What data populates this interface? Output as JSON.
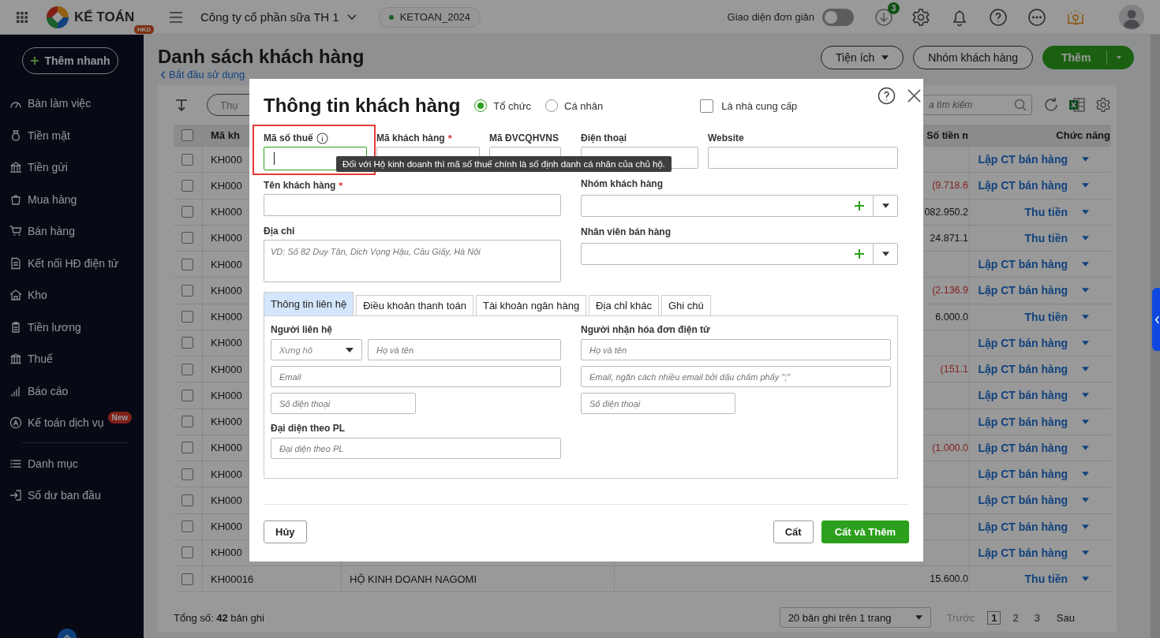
{
  "topbar": {
    "app_name": "KẾ TOÁN",
    "app_badge": "HKD",
    "company": "Công ty cổ phần sữa TH 1",
    "database": "KETOAN_2024",
    "simple_mode": {
      "label": "Giao diện đơn giản",
      "on": false
    },
    "download_count": "3"
  },
  "sidebar": {
    "quick_add": "Thêm nhanh",
    "groups": [
      [
        {
          "label": "Bàn làm việc"
        },
        {
          "label": "Tiền mặt"
        },
        {
          "label": "Tiền gửi"
        },
        {
          "label": "Mua hàng"
        },
        {
          "label": "Bán hàng"
        },
        {
          "label": "Kết nối HĐ điện tử"
        },
        {
          "label": "Kho"
        },
        {
          "label": "Tiền lương"
        },
        {
          "label": "Thuế"
        },
        {
          "label": "Báo cáo"
        },
        {
          "label": "Kế toán dịch vụ",
          "badge": "New"
        }
      ],
      [
        {
          "label": "Danh mục"
        },
        {
          "label": "Số dư ban đầu"
        }
      ]
    ]
  },
  "page": {
    "title": "Danh sách khách hàng",
    "back_link": "Bắt đầu sử dụng",
    "utilities": "Tiện ích",
    "customer_groups": "Nhóm khách hàng",
    "add": "Thêm",
    "filter_chip": "Thụ",
    "search_placeholder": "a tìm kiếm"
  },
  "table": {
    "select_all_checked": false,
    "columns": {
      "code": "Mã kh",
      "amount": "Số tiền n",
      "action": "Chức năng"
    },
    "rows": [
      {
        "checked": false,
        "code": "KH000",
        "action": "Lập CT bán hàng"
      },
      {
        "checked": false,
        "code": "KH000",
        "amount": "(9.718.6",
        "negative": true,
        "action": "Lập CT bán hàng"
      },
      {
        "checked": false,
        "code": "KH000",
        "amount": "082.950.2",
        "negative": false,
        "action": "Thu tiền"
      },
      {
        "checked": false,
        "code": "KH000",
        "amount": "24.871.1",
        "negative": false,
        "action": "Thu tiền"
      },
      {
        "checked": false,
        "code": "KH000",
        "action": "Lập CT bán hàng"
      },
      {
        "checked": false,
        "code": "KH000",
        "amount": "(2.136.9",
        "negative": true,
        "action": "Lập CT bán hàng"
      },
      {
        "checked": false,
        "code": "KH000",
        "amount": "6.000.0",
        "negative": false,
        "action": "Thu tiền"
      },
      {
        "checked": false,
        "code": "KH000",
        "action": "Lập CT bán hàng"
      },
      {
        "checked": false,
        "code": "KH000",
        "amount": "(151.1",
        "negative": true,
        "action": "Lập CT bán hàng"
      },
      {
        "checked": false,
        "code": "KH000",
        "action": "Lập CT bán hàng"
      },
      {
        "checked": false,
        "code": "KH000",
        "action": "Lập CT bán hàng"
      },
      {
        "checked": false,
        "code": "KH000",
        "amount": "(1.000.0",
        "negative": true,
        "action": "Lập CT bán hàng"
      },
      {
        "checked": false,
        "code": "KH000",
        "action": "Lập CT bán hàng"
      },
      {
        "checked": false,
        "code": "KH000",
        "action": "Lập CT bán hàng"
      },
      {
        "checked": false,
        "code": "KH000",
        "action": "Lập CT bán hàng"
      },
      {
        "checked": false,
        "code": "KH000",
        "action": "Lập CT bán hàng"
      },
      {
        "checked": false,
        "code": "KH00016",
        "name": "HỘ KINH DOANH NAGOMI",
        "amount": "15.600.0",
        "negative": false,
        "action": "Thu tiền"
      }
    ],
    "total": "Tổng số: **42** bản ghi",
    "pagination": {
      "page_size": "20 bản ghi trên 1 trang",
      "prev": {
        "label": "Trước",
        "disabled": true
      },
      "pages": [
        {
          "label": "1",
          "selected": true
        },
        {
          "label": "2",
          "selected": false
        },
        {
          "label": "3",
          "selected": false
        }
      ],
      "next": {
        "label": "Sau",
        "disabled": false
      }
    }
  },
  "modal": {
    "title": "Thông tin khách hàng",
    "customer_type": [
      {
        "label": "Tổ chức",
        "selected": true
      },
      {
        "label": "Cá nhân",
        "selected": false
      }
    ],
    "is_supplier": {
      "label": "Là nhà cung cấp",
      "checked": false
    },
    "code_fields": [
      {
        "label": "Mã số thuế",
        "info": true,
        "focused": true,
        "highlighted": true
      },
      {
        "label": "Mã khách hàng",
        "required_mark": "*",
        "info": false,
        "focused": false,
        "highlighted": false
      },
      {
        "label": "Mã ĐVCQHVNS",
        "info": false,
        "focused": false,
        "highlighted": false
      }
    ],
    "contact_fields": [
      {
        "label": "Điện thoại"
      },
      {
        "label": "Website"
      }
    ],
    "tooltip": "Đối với Hộ kinh doanh thì mã số thuế chính là số định danh cá nhân của chủ hộ.",
    "name_field": {
      "label": "Tên khách hàng",
      "required_mark": "*"
    },
    "group_field": {
      "label": "Nhóm khách hàng"
    },
    "address_field": {
      "label": "Địa chỉ",
      "placeholder": "VD: Số 82 Duy Tân, Dịch Vọng Hậu, Cầu Giấy, Hà Nội"
    },
    "sales_field": {
      "label": "Nhân viên bán hàng"
    },
    "tabs": [
      {
        "label": "Thông tin liên hệ",
        "selected": true
      },
      {
        "label": "Điều khoản thanh toán",
        "selected": false
      },
      {
        "label": "Tài khoản ngân hàng",
        "selected": false
      },
      {
        "label": "Địa chỉ khác",
        "selected": false
      },
      {
        "label": "Ghi chú",
        "selected": false
      }
    ],
    "contact": {
      "label": "Người liên hệ",
      "salutation_placeholder": "Xưng hô",
      "name_placeholder": "Họ và tên",
      "email_placeholder": "Email",
      "phone_placeholder": "Số điện thoại",
      "legal_rep_label": "Đại diện theo PL",
      "legal_rep_placeholder": "Đại diện theo PL"
    },
    "invoice_receiver": {
      "label": "Người nhận hóa đơn điện tử",
      "name_placeholder": "Họ và tên",
      "email_placeholder": "Email, ngăn cách nhiều email bởi dấu chấm phẩy \";\"",
      "phone_placeholder": "Số điện thoại"
    },
    "buttons": {
      "cancel": "Hủy",
      "save": "Cất",
      "save_add": "Cất và Thêm"
    }
  }
}
